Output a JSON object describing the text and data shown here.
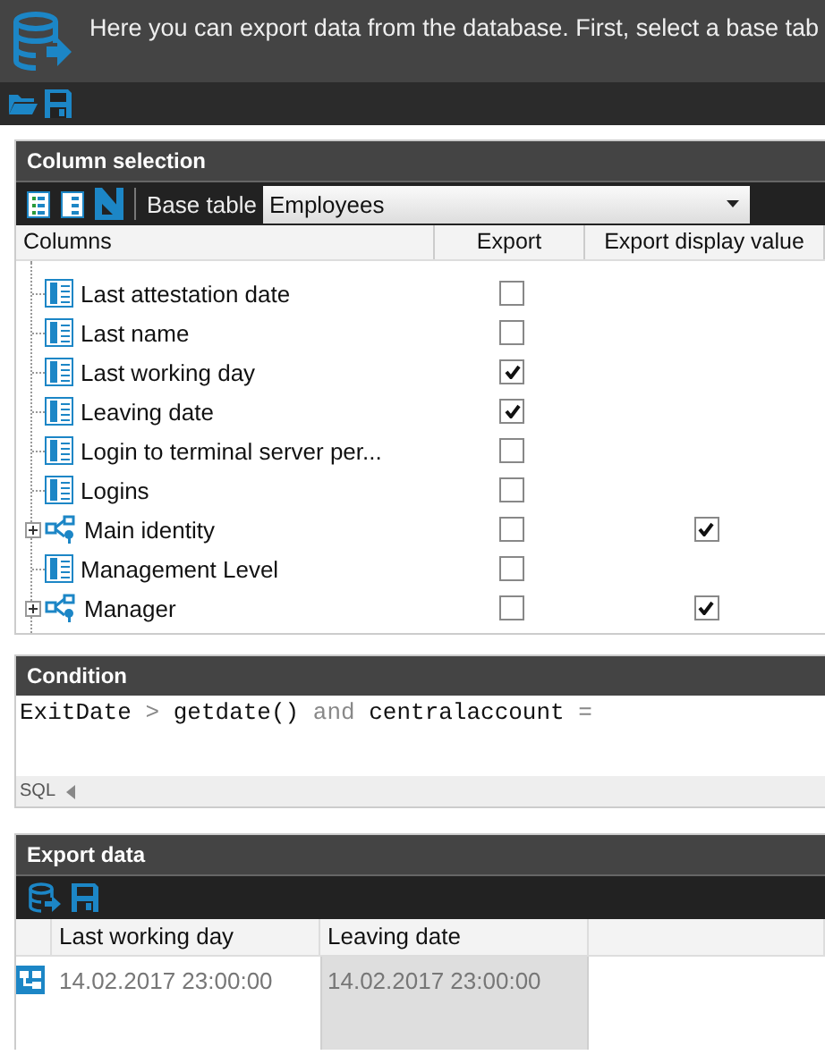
{
  "header": {
    "text": "Here you can export data from the database. First, select a base tab"
  },
  "column_selection": {
    "title": "Column selection",
    "base_table_label": "Base table",
    "base_table": "Employees",
    "columns": [
      "Columns",
      "Export",
      "Export display value"
    ],
    "items": [
      {
        "kind": "column",
        "name": "Last attestation date",
        "export": false
      },
      {
        "kind": "column",
        "name": "Last name",
        "export": false
      },
      {
        "kind": "column",
        "name": "Last working day",
        "export": true
      },
      {
        "kind": "column",
        "name": "Leaving date",
        "export": true
      },
      {
        "kind": "column",
        "name": "Login to terminal server per...",
        "export": false
      },
      {
        "kind": "column",
        "name": "Logins",
        "export": false
      },
      {
        "kind": "relation",
        "name": "Main identity",
        "export": false,
        "display_value": true,
        "expanded": false
      },
      {
        "kind": "column",
        "name": "Management Level",
        "export": false
      },
      {
        "kind": "relation",
        "name": "Manager",
        "export": false,
        "display_value": true,
        "expanded": false
      }
    ]
  },
  "condition": {
    "title": "Condition",
    "tokens": [
      {
        "kind": "ident",
        "text": "ExitDate"
      },
      {
        "kind": "operator",
        "text": ">"
      },
      {
        "kind": "ident",
        "text": "getdate()"
      },
      {
        "kind": "keyword",
        "text": "and"
      },
      {
        "kind": "ident",
        "text": "centralaccount"
      },
      {
        "kind": "operator",
        "text": "="
      }
    ],
    "language": "SQL"
  },
  "export_data": {
    "title": "Export data",
    "columns": [
      {
        "label": "Last working day",
        "selected": false
      },
      {
        "label": "Leaving date",
        "selected": true
      }
    ],
    "rows": [
      {
        "cells": [
          "14.02.2017 23:00:00",
          "14.02.2017 23:00:00"
        ]
      }
    ]
  }
}
